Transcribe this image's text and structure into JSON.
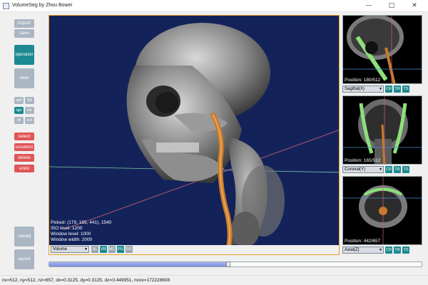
{
  "window": {
    "title": "VolumeSeg by Zhou Bowei",
    "controls": [
      "—",
      "□",
      "✕"
    ]
  },
  "left_panel": {
    "file": {
      "import": "import",
      "save": "save"
    },
    "modes": {
      "operation": "operation",
      "view": "view"
    },
    "ops": [
      "sph",
      "fld",
      "rgn",
      "lck",
      "dil",
      "ero"
    ],
    "edit": [
      "select",
      "unselect",
      "delete",
      "undo"
    ],
    "bottom": {
      "reload": "reload",
      "layout": "layout"
    }
  },
  "main_view": {
    "info": {
      "picked": "Picked: (179, 165, 441), 1540",
      "iso": "ISO level: 1200",
      "window_level": "Window level: 1000",
      "window_width": "Window width: 2000"
    },
    "mode_select": "Volume",
    "chips": [
      "SL",
      "VR",
      "MC",
      "PU",
      "SG"
    ]
  },
  "side_views": [
    {
      "position": "Position: 180/512",
      "select": "Sagittal(X)",
      "chips": [
        "CR",
        "TR",
        "TS"
      ]
    },
    {
      "position": "Position: 165/512",
      "select": "Coronal(Y)",
      "chips": [
        "CR",
        "TR",
        "TS"
      ]
    },
    {
      "position": "Position: 442/657",
      "select": "Axial(Z)",
      "chips": [
        "CR",
        "TR",
        "TS"
      ]
    }
  ],
  "slider": {
    "value_fraction": 0.48
  },
  "status": "nx=512, ny=512, nz=657, dx=0.3125, dy=0.3125, dz=0.449951, nvox=172228608",
  "colors": {
    "accent_teal": "#1c8a90",
    "danger_red": "#e05556",
    "viewport_bg": "#13235a",
    "focus_orange": "#e6a02a"
  }
}
